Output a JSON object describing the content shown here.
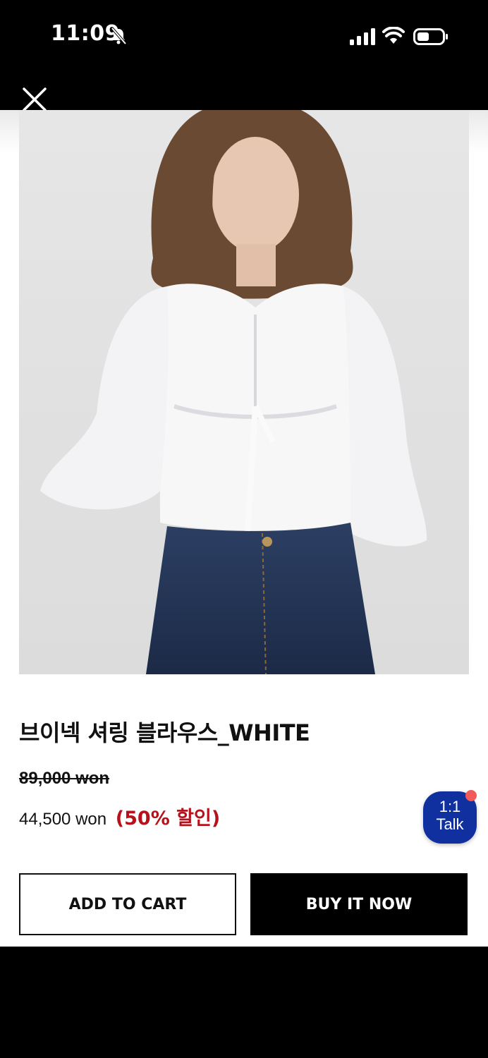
{
  "status_bar": {
    "time": "11:09",
    "bell_muted_icon": "bell-slash-icon",
    "signal_icon": "cellular-signal-icon",
    "wifi_icon": "wifi-icon",
    "battery_icon": "battery-icon"
  },
  "header": {
    "close_icon": "close-icon"
  },
  "product": {
    "title": "브이넥 셔링 블라우스_WHITE",
    "original_price": "89,000 won",
    "sale_price": "44,500 won",
    "discount_label": "(50% 할인)"
  },
  "chat": {
    "line1": "1:1",
    "line2": "Talk"
  },
  "actions": {
    "add_to_cart": "ADD TO CART",
    "buy_now": "BUY IT NOW"
  },
  "colors": {
    "discount": "#b5121b",
    "talk_bubble": "#1130a0",
    "notification_dot": "#f15a5a"
  }
}
